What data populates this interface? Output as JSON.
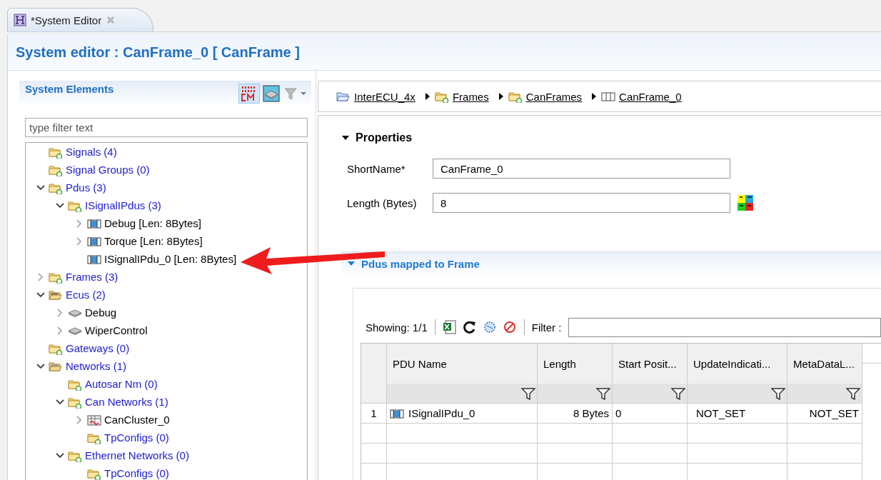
{
  "editor_tab": {
    "title": "*System Editor",
    "selected": true
  },
  "header": {
    "title": "System editor : CanFrame_0 [ CanFrame ]"
  },
  "system_elements": {
    "title": "System Elements",
    "filter_placeholder": "type filter text",
    "tree": [
      {
        "label": "Signals (4)",
        "kind": "folder",
        "expandable": false
      },
      {
        "label": "Signal Groups (0)",
        "kind": "folder",
        "expandable": false
      },
      {
        "label": "Pdus (3)",
        "kind": "folder",
        "expandable": true,
        "expanded": true,
        "children": [
          {
            "label": "ISignalIPdus (3)",
            "kind": "folder",
            "expandable": true,
            "expanded": true,
            "children": [
              {
                "label": "Debug [Len: 8Bytes]",
                "kind": "pdu",
                "expandable": true,
                "expanded": false
              },
              {
                "label": "Torque [Len: 8Bytes]",
                "kind": "pdu",
                "expandable": true,
                "expanded": false
              },
              {
                "label": "ISignalIPdu_0 [Len: 8Bytes]",
                "kind": "pdu",
                "expandable": false
              }
            ]
          }
        ]
      },
      {
        "label": "Frames (3)",
        "kind": "folder",
        "expandable": true,
        "expanded": false
      },
      {
        "label": "Ecus (2)",
        "kind": "ecu-folder",
        "expandable": true,
        "expanded": true,
        "children": [
          {
            "label": "Debug",
            "kind": "ecu",
            "expandable": true,
            "expanded": false
          },
          {
            "label": "WiperControl",
            "kind": "ecu",
            "expandable": true,
            "expanded": false
          }
        ]
      },
      {
        "label": "Gateways (0)",
        "kind": "folder",
        "expandable": false
      },
      {
        "label": "Networks (1)",
        "kind": "network-folder",
        "expandable": true,
        "expanded": true,
        "children": [
          {
            "label": "Autosar Nm (0)",
            "kind": "folder",
            "expandable": false
          },
          {
            "label": "Can Networks (1)",
            "kind": "folder",
            "expandable": true,
            "expanded": true,
            "children": [
              {
                "label": "CanCluster_0",
                "kind": "cluster",
                "expandable": true,
                "expanded": false
              },
              {
                "label": "TpConfigs (0)",
                "kind": "folder",
                "expandable": false
              }
            ]
          },
          {
            "label": "Ethernet Networks (0)",
            "kind": "folder",
            "expandable": true,
            "expanded": true,
            "children": [
              {
                "label": "TpConfigs (0)",
                "kind": "folder",
                "expandable": false
              }
            ]
          }
        ]
      }
    ]
  },
  "annotation_arrow": true,
  "breadcrumb": [
    {
      "label": "InterECU_4x",
      "kind": "project"
    },
    {
      "label": "Frames",
      "kind": "folder"
    },
    {
      "label": "CanFrames",
      "kind": "folder"
    },
    {
      "label": "CanFrame_0",
      "kind": "frame"
    }
  ],
  "properties": {
    "title": "Properties",
    "expanded": true,
    "fields": [
      {
        "label": "ShortName*",
        "value": "CanFrame_0",
        "base_icon": false
      },
      {
        "label": "Length (Bytes)",
        "value": "8",
        "base_icon": true
      }
    ]
  },
  "pdus_section": {
    "title": "Pdus mapped to Frame",
    "expanded": true,
    "showing": "Showing: 1/1",
    "filter_label": "Filter :",
    "columns": [
      "PDU Name",
      "Length",
      "Start Posit...",
      "UpdateIndicati...",
      "MetaDataL..."
    ],
    "rows": [
      {
        "number": "1",
        "cells": [
          "ISignalIPdu_0",
          "8 Bytes",
          "0",
          "NOT_SET",
          "NOT_SET"
        ]
      }
    ]
  }
}
